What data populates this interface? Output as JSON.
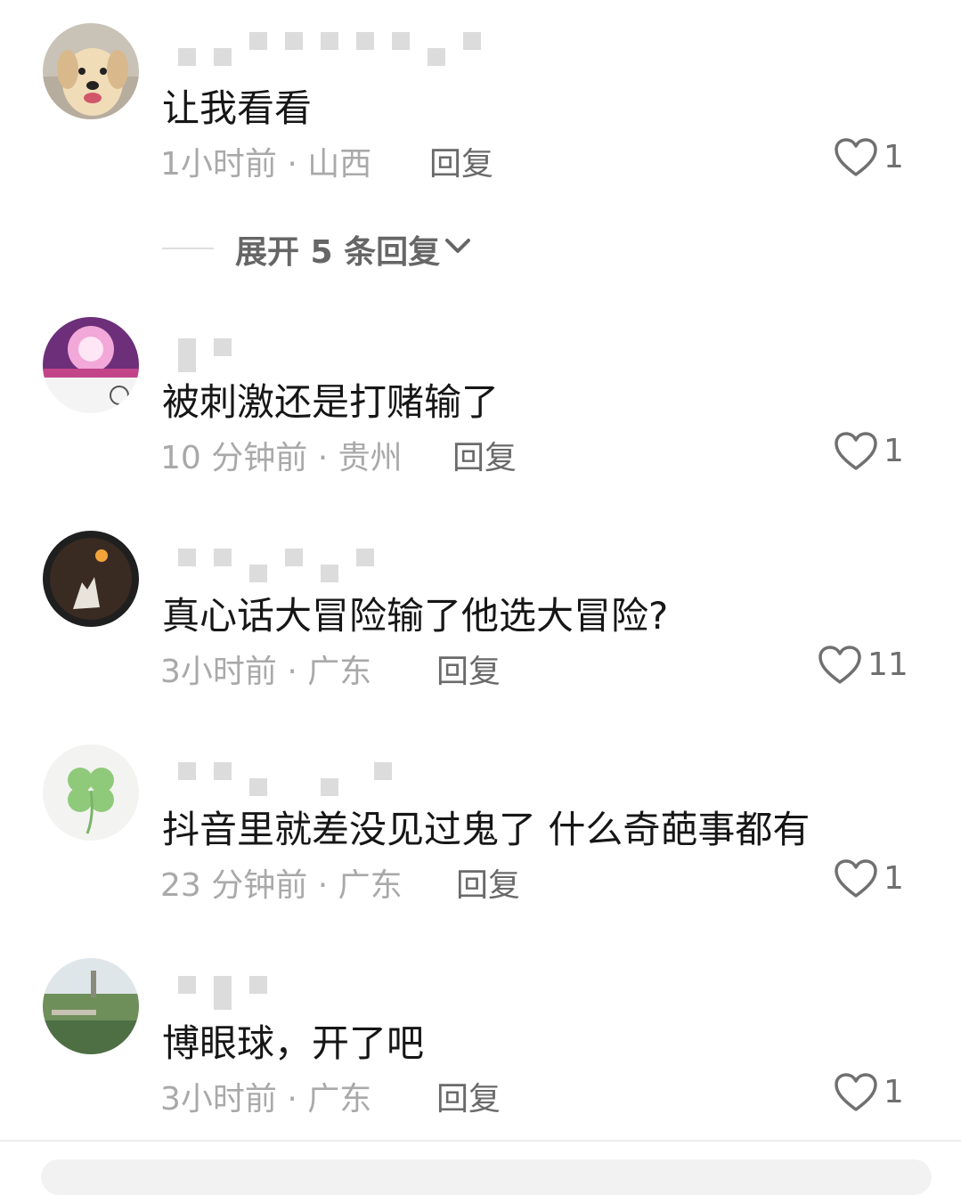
{
  "comments": [
    {
      "text": "让我看看",
      "time": "1小时前",
      "location": "山西",
      "reply": "回复",
      "likes": "1"
    },
    {
      "text": "被刺激还是打赌输了",
      "time": "10 分钟前",
      "location": "贵州",
      "reply": "回复",
      "likes": "1"
    },
    {
      "text": "真心话大冒险输了他选大冒险?",
      "time": "3小时前",
      "location": "广东",
      "reply": "回复",
      "likes": "11"
    },
    {
      "text": "抖音里就差没见过鬼了 什么奇葩事都有",
      "time": "23 分钟前",
      "location": "广东",
      "reply": "回复",
      "likes": "1"
    },
    {
      "text": "博眼球，开了吧",
      "time": "3小时前",
      "location": "广东",
      "reply": "回复",
      "likes": "1"
    }
  ],
  "expand_replies": "展开 5 条回复",
  "meta_separator": " · ",
  "colors": {
    "text": "#161616",
    "meta": "#a9a9a9",
    "reply": "#6a6a6a",
    "icon": "#707070"
  },
  "icons": [
    "heart-outline-icon",
    "chevron-down-icon"
  ]
}
